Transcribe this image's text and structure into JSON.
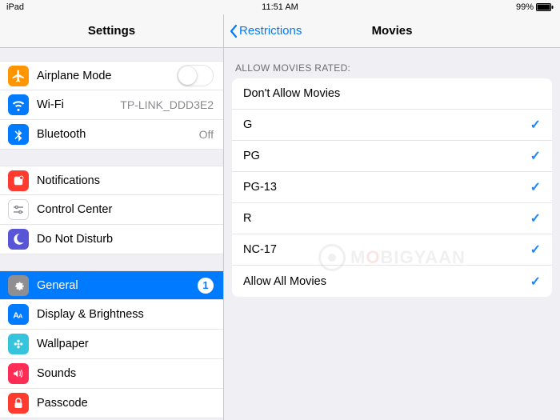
{
  "status": {
    "device": "iPad",
    "time": "11:51 AM",
    "battery_pct": "99%"
  },
  "left": {
    "title": "Settings",
    "groups": {
      "network": {
        "airplane": {
          "label": "Airplane Mode",
          "on": false
        },
        "wifi": {
          "label": "Wi-Fi",
          "value": "TP-LINK_DDD3E2"
        },
        "bluetooth": {
          "label": "Bluetooth",
          "value": "Off"
        }
      },
      "notify": {
        "notifications": {
          "label": "Notifications"
        },
        "control_center": {
          "label": "Control Center"
        },
        "dnd": {
          "label": "Do Not Disturb"
        }
      },
      "device": {
        "general": {
          "label": "General",
          "badge": "1"
        },
        "display": {
          "label": "Display & Brightness"
        },
        "wallpaper": {
          "label": "Wallpaper"
        },
        "sounds": {
          "label": "Sounds"
        },
        "passcode": {
          "label": "Passcode"
        }
      }
    }
  },
  "right": {
    "back": "Restrictions",
    "title": "Movies",
    "section": "ALLOW MOVIES RATED:",
    "options": [
      {
        "label": "Don't Allow Movies",
        "checked": false
      },
      {
        "label": "G",
        "checked": true
      },
      {
        "label": "PG",
        "checked": true
      },
      {
        "label": "PG-13",
        "checked": true
      },
      {
        "label": "R",
        "checked": true
      },
      {
        "label": "NC-17",
        "checked": true
      },
      {
        "label": "Allow All Movies",
        "checked": true
      }
    ]
  },
  "watermark": {
    "pre": "M",
    "mid": "O",
    "post": "BIGYAAN"
  },
  "icons": {
    "airplane": "#ff9500",
    "wifi": "#007aff",
    "bluetooth": "#007aff",
    "notifications": "#ff3b30",
    "control_center": "#ffffff",
    "dnd": "#5856d6",
    "general": "#8e8e93",
    "display": "#007aff",
    "wallpaper": "#35c4dc",
    "sounds": "#ff2d55",
    "passcode": "#ff3b30"
  }
}
